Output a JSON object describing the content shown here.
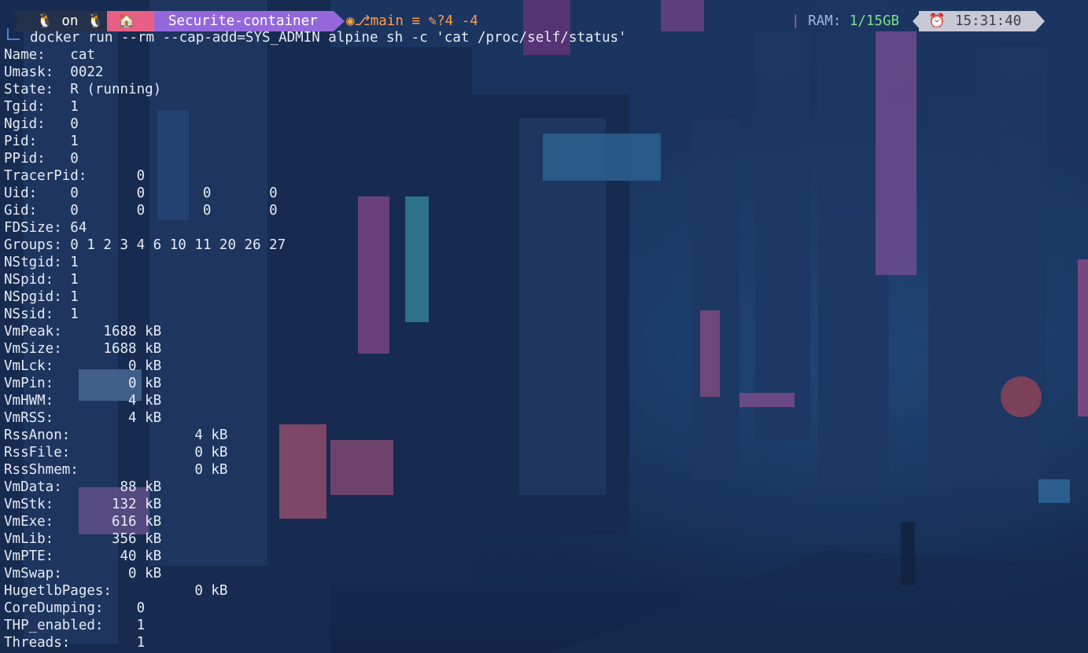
{
  "prompt": {
    "os_label": "on",
    "path": "Securite-container",
    "git_branch": "main",
    "git_branch_marker": "≡",
    "git_status": "?4 -4",
    "ram_label": "RAM:",
    "ram_value": "1/15GB",
    "ram_separator": "|",
    "time": "15:31:40"
  },
  "command": "docker run --rm --cap-add=SYS_ADMIN alpine sh -c 'cat /proc/self/status'",
  "output_lines": [
    "Name:   cat",
    "Umask:  0022",
    "State:  R (running)",
    "Tgid:   1",
    "Ngid:   0",
    "Pid:    1",
    "PPid:   0",
    "TracerPid:      0",
    "Uid:    0       0       0       0",
    "Gid:    0       0       0       0",
    "FDSize: 64",
    "Groups: 0 1 2 3 4 6 10 11 20 26 27",
    "NStgid: 1",
    "NSpid:  1",
    "NSpgid: 1",
    "NSsid:  1",
    "VmPeak:     1688 kB",
    "VmSize:     1688 kB",
    "VmLck:         0 kB",
    "VmPin:         0 kB",
    "VmHWM:         4 kB",
    "VmRSS:         4 kB",
    "RssAnon:               4 kB",
    "RssFile:               0 kB",
    "RssShmem:              0 kB",
    "VmData:       88 kB",
    "VmStk:       132 kB",
    "VmExe:       616 kB",
    "VmLib:       356 kB",
    "VmPTE:        40 kB",
    "VmSwap:        0 kB",
    "HugetlbPages:          0 kB",
    "CoreDumping:    0",
    "THP_enabled:    1",
    "Threads:        1"
  ],
  "colors": {
    "os_segment": "#24314a",
    "home_segment": "#e85f86",
    "path_segment": "#9468db",
    "git_text": "#ff9d46",
    "ram_value": "#7be08c",
    "time_segment": "#c7c9d4",
    "terminal_text": "#e7ebf3"
  },
  "icons": [
    "linux-tux-icon",
    "home-icon",
    "github-icon",
    "git-branch-icon",
    "edit-icon",
    "alarm-clock-icon"
  ]
}
